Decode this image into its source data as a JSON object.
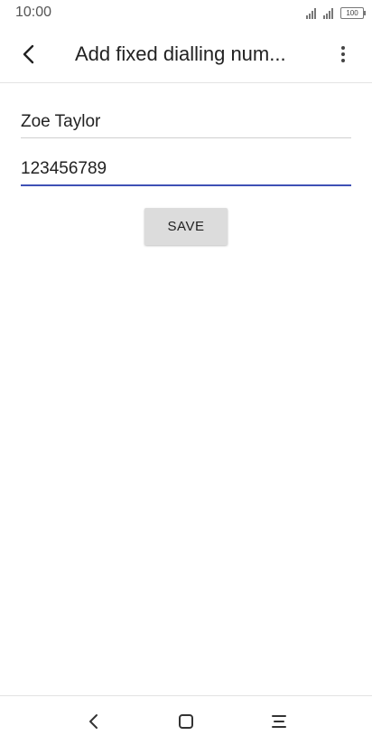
{
  "status_bar": {
    "time": "10:00",
    "battery": "100",
    "icons": [
      "signal-icon",
      "signal-icon",
      "battery-icon"
    ]
  },
  "app_bar": {
    "title": "Add fixed dialling num...",
    "icons": {
      "back": "back-arrow-icon",
      "more": "more-vertical-icon"
    }
  },
  "form": {
    "name_value": "Zoe Taylor",
    "number_value": "123456789",
    "save_label": "SAVE"
  },
  "nav_bar": {
    "icons": [
      "nav-back-icon",
      "nav-home-icon",
      "nav-menu-icon"
    ]
  },
  "colors": {
    "accent": "#3f51b5",
    "button_bg": "#dcdcdc",
    "divider": "#e3e3e3"
  }
}
